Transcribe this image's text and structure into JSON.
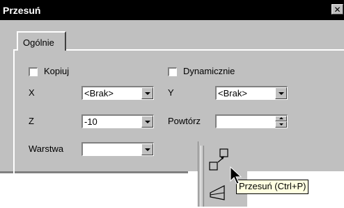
{
  "window": {
    "title": "Przesuń",
    "close_glyph": "✕"
  },
  "tabs": [
    {
      "label": "Ogólnie",
      "active": true
    }
  ],
  "form": {
    "kopiuj": {
      "label": "Kopiuj",
      "checked": false
    },
    "dynamicznie": {
      "label": "Dynamicznie",
      "checked": false
    },
    "x": {
      "label": "X",
      "value": "<Brak>"
    },
    "y": {
      "label": "Y",
      "value": "<Brak>"
    },
    "z": {
      "label": "Z",
      "value": "-10"
    },
    "powtorz": {
      "label": "Powtórz",
      "value": ""
    },
    "warstwa": {
      "label": "Warstwa",
      "value": ""
    }
  },
  "toolbar": {
    "buttons": [
      {
        "icon": "move-icon"
      },
      {
        "icon": "perspective-plane-icon"
      }
    ],
    "tooltip": "Przesuń (Ctrl+P)"
  },
  "colors": {
    "dialog_bg": "#c0c0c0",
    "titlebar_bg": "#000000",
    "tooltip_bg": "#ffffe1"
  }
}
